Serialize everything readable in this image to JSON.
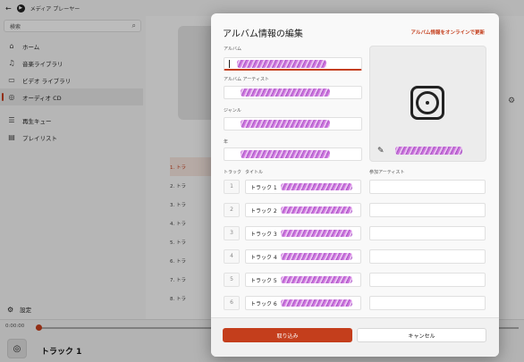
{
  "app": {
    "title": "メディア プレーヤー",
    "search_placeholder": "検索",
    "nav": [
      {
        "label": "ホーム",
        "icon": "home-icon"
      },
      {
        "label": "音楽ライブラリ",
        "icon": "music-note-icon"
      },
      {
        "label": "ビデオ ライブラリ",
        "icon": "video-icon"
      },
      {
        "label": "オーディオ CD",
        "icon": "cd-icon"
      },
      {
        "label": "再生キュー",
        "icon": "queue-icon"
      },
      {
        "label": "プレイリスト",
        "icon": "playlist-icon"
      }
    ],
    "settings_label": "設定",
    "tracklist": [
      "1. トラ",
      "2. トラ",
      "3. トラ",
      "4. トラ",
      "5. トラ",
      "6. トラ",
      "7. トラ",
      "8. トラ"
    ],
    "player": {
      "time": "0:00:00",
      "now_playing": "トラック 1"
    }
  },
  "dialog": {
    "title": "アルバム情報の編集",
    "online_link": "アルバム情報をオンラインで更新",
    "labels": {
      "album": "アルバム",
      "album_artist": "アルバム アーティスト",
      "genre": "ジャンル",
      "year": "年",
      "track_col": "トラック",
      "title_col": "タイトル",
      "artist_col": "参加アーティスト"
    },
    "tracks": [
      {
        "num": "1",
        "title": "トラック 1"
      },
      {
        "num": "2",
        "title": "トラック 2"
      },
      {
        "num": "3",
        "title": "トラック 3"
      },
      {
        "num": "4",
        "title": "トラック 4"
      },
      {
        "num": "5",
        "title": "トラック 5"
      },
      {
        "num": "6",
        "title": "トラック 6"
      }
    ],
    "import_button": "取り込み",
    "cancel_button": "キャンセル"
  },
  "colors": {
    "accent": "#c43e1c",
    "redaction": "#c55cd8"
  }
}
